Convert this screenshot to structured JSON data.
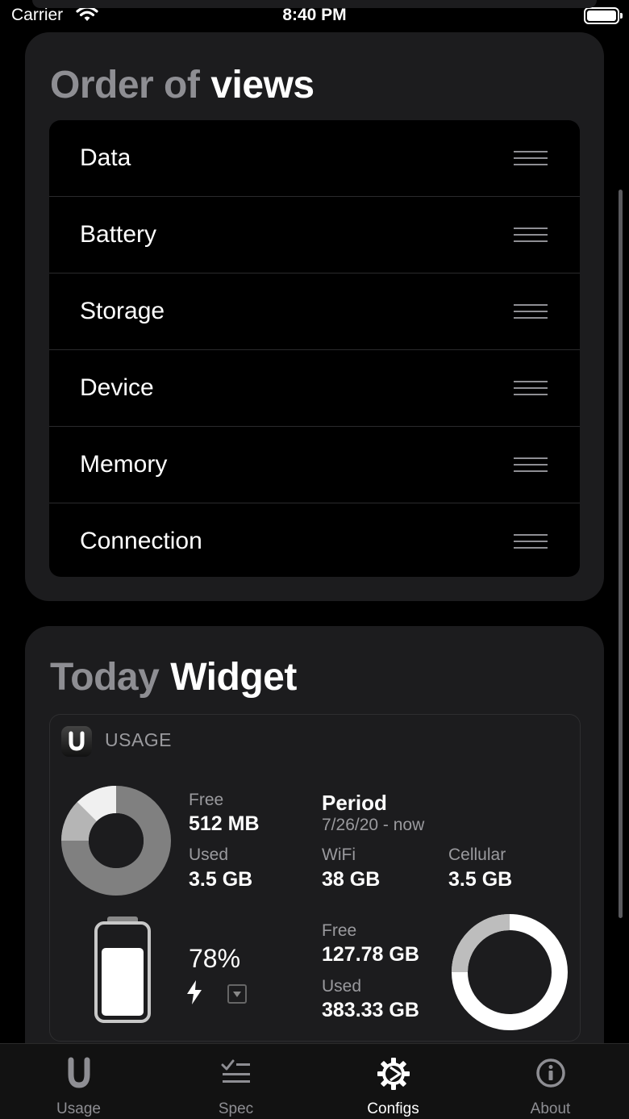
{
  "status_bar": {
    "carrier": "Carrier",
    "time": "8:40 PM"
  },
  "order_card": {
    "title_grey": "Order of",
    "title_white": "views",
    "items": [
      {
        "label": "Data"
      },
      {
        "label": "Battery"
      },
      {
        "label": "Storage"
      },
      {
        "label": "Device"
      },
      {
        "label": "Memory"
      },
      {
        "label": "Connection"
      }
    ]
  },
  "widget_card": {
    "title_grey": "Today",
    "title_white": "Widget",
    "widget": {
      "app_name": "USAGE",
      "memory": {
        "free_label": "Free",
        "free_value": "512 MB",
        "used_label": "Used",
        "used_value": "3.5 GB"
      },
      "data": {
        "period_label": "Period",
        "period_range": "7/26/20 - now",
        "wifi_label": "WiFi",
        "wifi_value": "38 GB",
        "cellular_label": "Cellular",
        "cellular_value": "3.5 GB"
      },
      "battery": {
        "percent_text": "78%",
        "level": 0.78
      },
      "storage": {
        "free_label": "Free",
        "free_value": "127.78 GB",
        "used_label": "Used",
        "used_value": "383.33 GB"
      }
    }
  },
  "tab_bar": {
    "tabs": [
      {
        "label": "Usage",
        "icon": "usage-u-icon",
        "active": false
      },
      {
        "label": "Spec",
        "icon": "spec-list-icon",
        "active": false
      },
      {
        "label": "Configs",
        "icon": "gear-icon",
        "active": true
      },
      {
        "label": "About",
        "icon": "info-icon",
        "active": false
      }
    ]
  },
  "colors": {
    "background": "#000000",
    "card": "#1c1c1e",
    "title_grey": "#8e8e93",
    "text": "#ffffff"
  }
}
